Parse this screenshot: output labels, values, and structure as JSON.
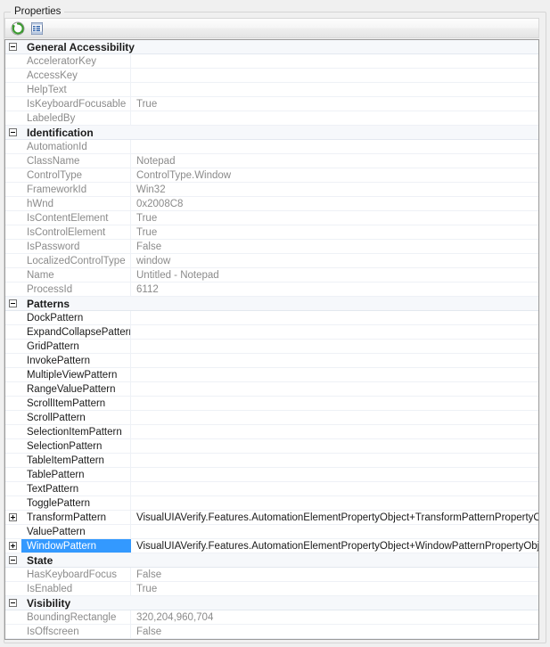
{
  "groupbox": {
    "title": "Properties"
  },
  "toolbar": {
    "refresh_label": "refresh",
    "properties_label": "properties"
  },
  "grid": {
    "rows": [
      {
        "kind": "category",
        "expander": "minus",
        "name": "General Accessibility",
        "value": ""
      },
      {
        "kind": "prop",
        "expander": "none",
        "name": "AcceleratorKey",
        "value": ""
      },
      {
        "kind": "prop",
        "expander": "none",
        "name": "AccessKey",
        "value": ""
      },
      {
        "kind": "prop",
        "expander": "none",
        "name": "HelpText",
        "value": ""
      },
      {
        "kind": "prop",
        "expander": "none",
        "name": "IsKeyboardFocusable",
        "value": "True"
      },
      {
        "kind": "prop",
        "expander": "none",
        "name": "LabeledBy",
        "value": ""
      },
      {
        "kind": "category",
        "expander": "minus",
        "name": "Identification",
        "value": ""
      },
      {
        "kind": "prop",
        "expander": "none",
        "name": "AutomationId",
        "value": ""
      },
      {
        "kind": "prop",
        "expander": "none",
        "name": "ClassName",
        "value": "Notepad"
      },
      {
        "kind": "prop",
        "expander": "none",
        "name": "ControlType",
        "value": "ControlType.Window"
      },
      {
        "kind": "prop",
        "expander": "none",
        "name": "FrameworkId",
        "value": "Win32"
      },
      {
        "kind": "prop",
        "expander": "none",
        "name": "hWnd",
        "value": "0x2008C8"
      },
      {
        "kind": "prop",
        "expander": "none",
        "name": "IsContentElement",
        "value": "True"
      },
      {
        "kind": "prop",
        "expander": "none",
        "name": "IsControlElement",
        "value": "True"
      },
      {
        "kind": "prop",
        "expander": "none",
        "name": "IsPassword",
        "value": "False"
      },
      {
        "kind": "prop",
        "expander": "none",
        "name": "LocalizedControlType",
        "value": "window"
      },
      {
        "kind": "prop",
        "expander": "none",
        "name": "Name",
        "value": "Untitled - Notepad"
      },
      {
        "kind": "prop",
        "expander": "none",
        "name": "ProcessId",
        "value": "6112"
      },
      {
        "kind": "category",
        "expander": "minus",
        "name": "Patterns",
        "value": ""
      },
      {
        "kind": "prop-dark",
        "expander": "none",
        "name": "DockPattern",
        "value": ""
      },
      {
        "kind": "prop-dark",
        "expander": "none",
        "name": "ExpandCollapsePattern",
        "value": ""
      },
      {
        "kind": "prop-dark",
        "expander": "none",
        "name": "GridPattern",
        "value": ""
      },
      {
        "kind": "prop-dark",
        "expander": "none",
        "name": "InvokePattern",
        "value": ""
      },
      {
        "kind": "prop-dark",
        "expander": "none",
        "name": "MultipleViewPattern",
        "value": ""
      },
      {
        "kind": "prop-dark",
        "expander": "none",
        "name": "RangeValuePattern",
        "value": ""
      },
      {
        "kind": "prop-dark",
        "expander": "none",
        "name": "ScrollItemPattern",
        "value": ""
      },
      {
        "kind": "prop-dark",
        "expander": "none",
        "name": "ScrollPattern",
        "value": ""
      },
      {
        "kind": "prop-dark",
        "expander": "none",
        "name": "SelectionItemPattern",
        "value": ""
      },
      {
        "kind": "prop-dark",
        "expander": "none",
        "name": "SelectionPattern",
        "value": ""
      },
      {
        "kind": "prop-dark",
        "expander": "none",
        "name": "TableItemPattern",
        "value": ""
      },
      {
        "kind": "prop-dark",
        "expander": "none",
        "name": "TablePattern",
        "value": ""
      },
      {
        "kind": "prop-dark",
        "expander": "none",
        "name": "TextPattern",
        "value": ""
      },
      {
        "kind": "prop-dark",
        "expander": "none",
        "name": "TogglePattern",
        "value": ""
      },
      {
        "kind": "prop-dark",
        "expander": "plus",
        "name": "TransformPattern",
        "value": "VisualUIAVerify.Features.AutomationElementPropertyObject+TransformPatternPropertyObject"
      },
      {
        "kind": "prop-dark",
        "expander": "none",
        "name": "ValuePattern",
        "value": ""
      },
      {
        "kind": "selected",
        "expander": "plus",
        "name": "WindowPattern",
        "value": "VisualUIAVerify.Features.AutomationElementPropertyObject+WindowPatternPropertyObject"
      },
      {
        "kind": "category",
        "expander": "minus",
        "name": "State",
        "value": ""
      },
      {
        "kind": "prop",
        "expander": "none",
        "name": "HasKeyboardFocus",
        "value": "False"
      },
      {
        "kind": "prop",
        "expander": "none",
        "name": "IsEnabled",
        "value": "True"
      },
      {
        "kind": "category",
        "expander": "minus",
        "name": "Visibility",
        "value": ""
      },
      {
        "kind": "prop",
        "expander": "none",
        "name": "BoundingRectangle",
        "value": "320,204,960,704"
      },
      {
        "kind": "prop",
        "expander": "none",
        "name": "IsOffscreen",
        "value": "False"
      }
    ]
  },
  "colors": {
    "selection": "#3399ff",
    "category_bg": "#f6f8fb",
    "grid_line": "#eef1f6",
    "dim_text": "#8b8b8b",
    "dark_text": "#1b1b1b"
  }
}
